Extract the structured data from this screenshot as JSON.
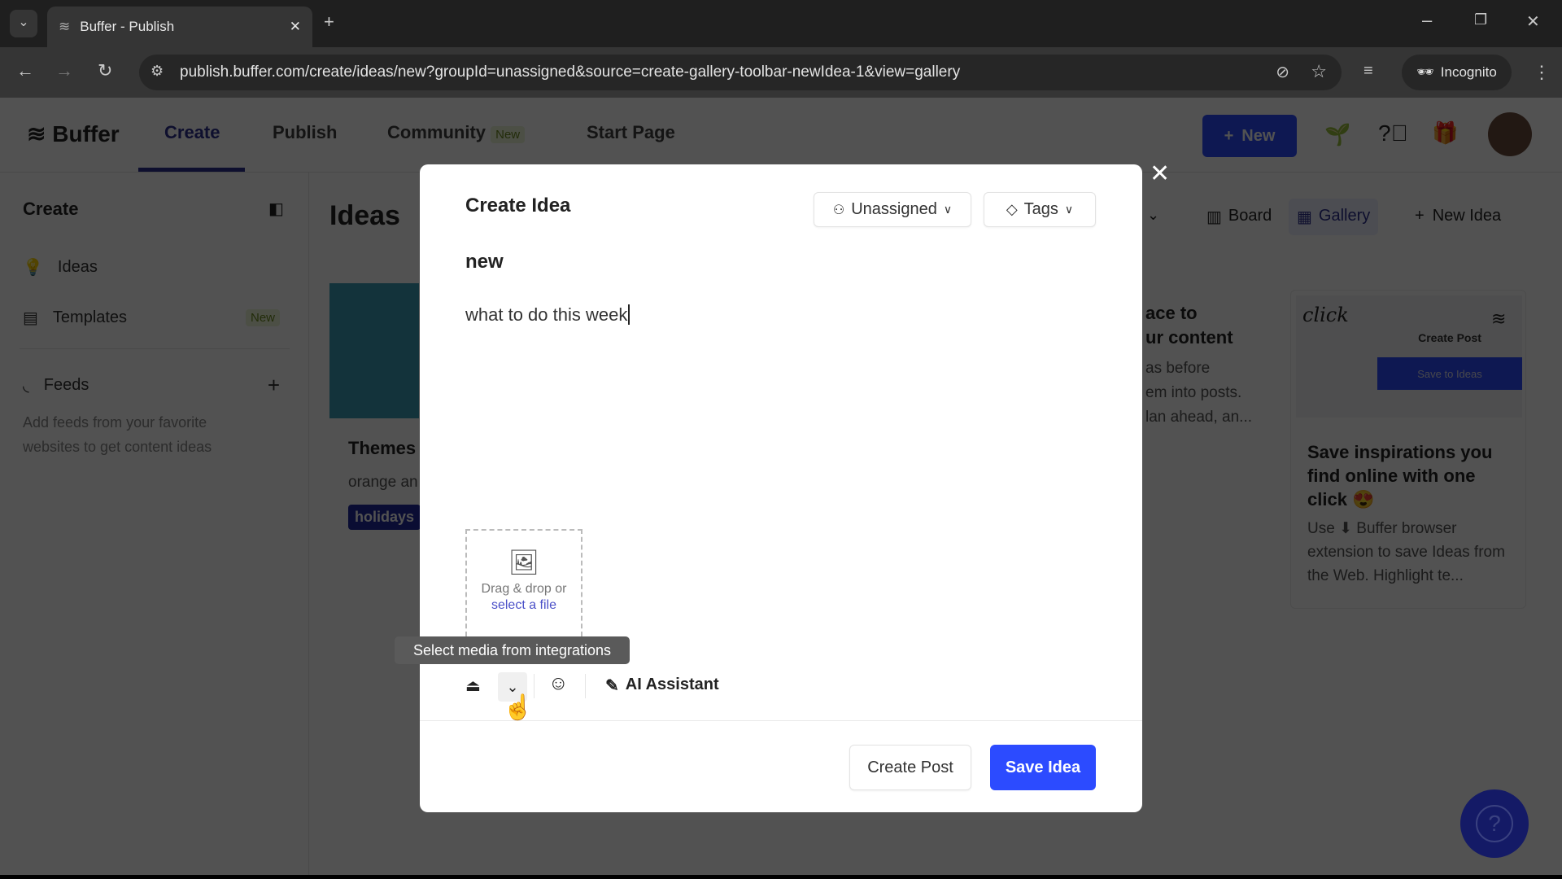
{
  "browser": {
    "tab_title": "Buffer - Publish",
    "url": "publish.buffer.com/create/ideas/new?groupId=unassigned&source=create-gallery-toolbar-newIdea-1&view=gallery",
    "incognito_label": "Incognito"
  },
  "nav": {
    "logo": "Buffer",
    "tabs": [
      {
        "label": "Create"
      },
      {
        "label": "Publish"
      },
      {
        "label": "Community",
        "badge": "New"
      },
      {
        "label": "Start Page"
      }
    ],
    "new_button": "New"
  },
  "sidebar": {
    "title": "Create",
    "items": [
      {
        "label": "Ideas"
      },
      {
        "label": "Templates",
        "badge": "New"
      }
    ],
    "feeds_label": "Feeds",
    "feeds_description": "Add feeds from your favorite websites to get content ideas"
  },
  "main": {
    "title": "Ideas",
    "toolbar": {
      "board": "Board",
      "gallery": "Gallery",
      "new_idea": "New Idea"
    },
    "cards": [
      {
        "title": "Themes",
        "body": "orange an",
        "tag": "holidays"
      },
      {
        "title_lines": [
          "ace to",
          "ur content"
        ],
        "body_lines": [
          "as before",
          "em into posts.",
          "lan ahead, an..."
        ]
      },
      {
        "illustration_text": "click",
        "illustration_create_post": "Create Post",
        "illustration_save": "Save to Ideas",
        "title": "Save inspirations you find online with one click 😍",
        "body": "Use ⬇ Buffer browser extension to save Ideas from the Web. Highlight te..."
      }
    ]
  },
  "modal": {
    "title": "Create Idea",
    "group_select": "Unassigned",
    "tags_select": "Tags",
    "idea_title": "new",
    "idea_body": "what to do this week",
    "dropzone_text": "Drag & drop or",
    "dropzone_link": "select a file",
    "tooltip": "Select media from integrations",
    "ai_assistant": "AI Assistant",
    "create_post": "Create Post",
    "save_idea": "Save Idea"
  },
  "colors": {
    "brand": "#2c4bff",
    "nav_active": "#2c2f8f",
    "tag_bg": "#1f2a9e"
  }
}
